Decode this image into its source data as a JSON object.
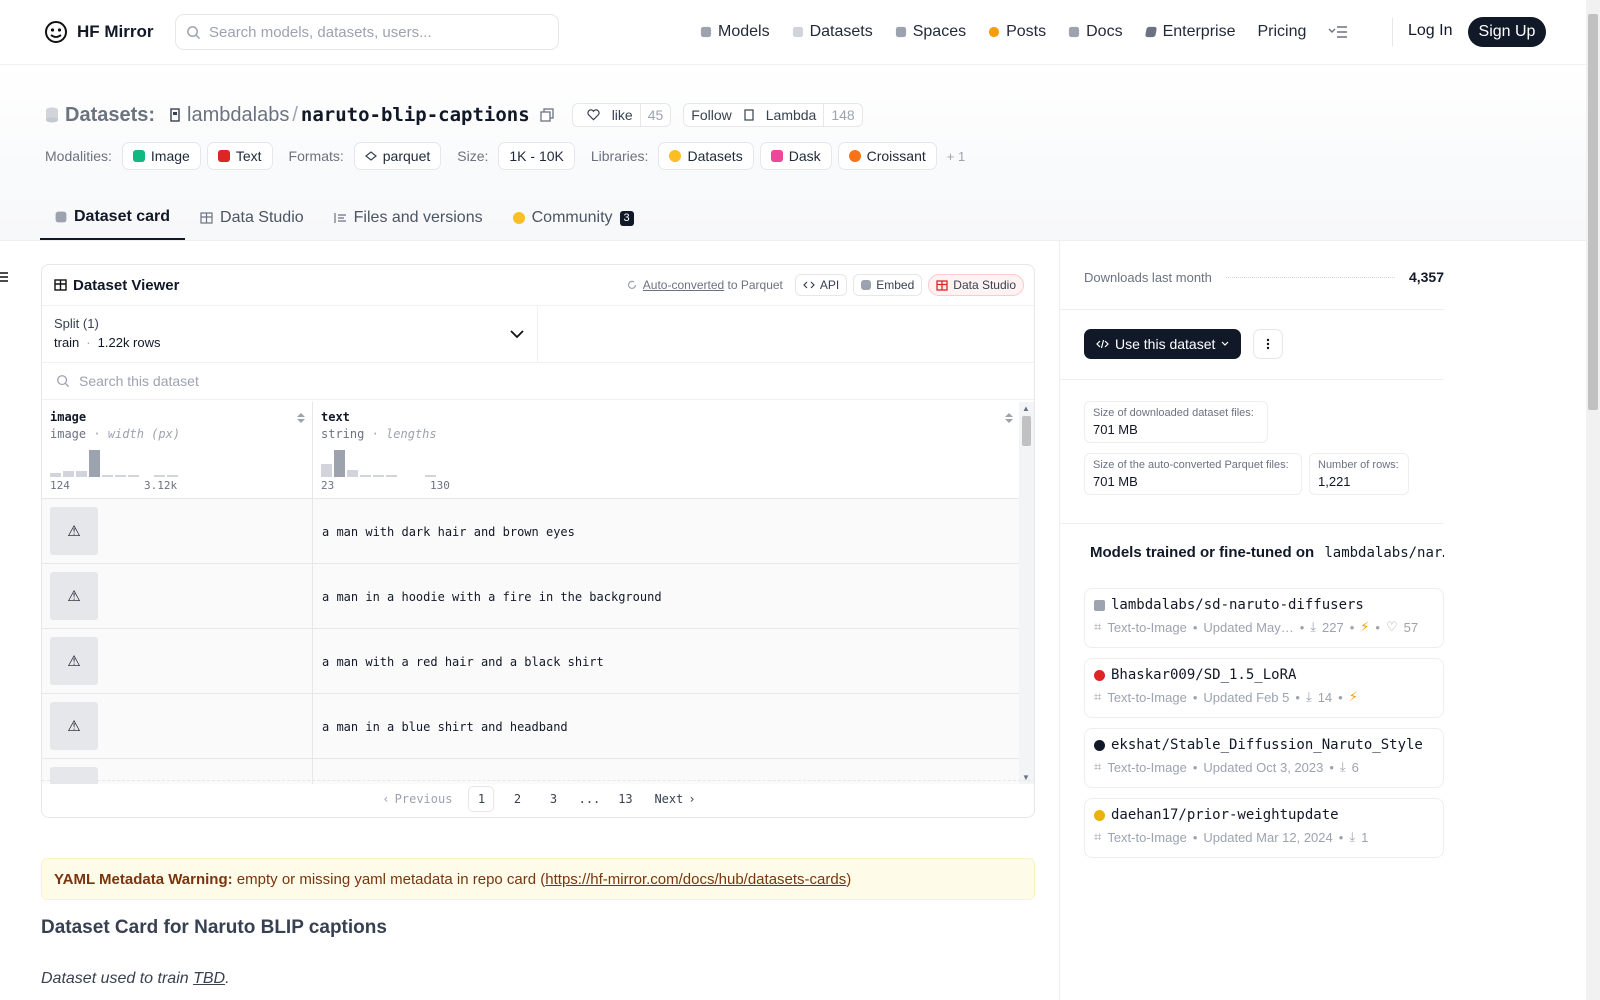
{
  "header": {
    "brand": "HF Mirror",
    "search_placeholder": "Search models, datasets, users...",
    "nav": [
      {
        "label": "Models",
        "icon": "cube-icon",
        "color": "#9ca3af"
      },
      {
        "label": "Datasets",
        "icon": "database-icon",
        "color": "#d1d5db"
      },
      {
        "label": "Spaces",
        "icon": "grid-icon",
        "color": "#9ca3af"
      },
      {
        "label": "Posts",
        "icon": "chat-icon",
        "color": "#f59e0b"
      },
      {
        "label": "Docs",
        "icon": "book-icon",
        "color": "#9ca3af"
      },
      {
        "label": "Enterprise",
        "icon": "enterprise-icon",
        "color": "#6b7280"
      },
      {
        "label": "Pricing",
        "icon": "",
        "color": ""
      }
    ],
    "login": "Log In",
    "signup": "Sign Up"
  },
  "repo": {
    "kind": "Datasets:",
    "owner": "lambdalabs",
    "name": "naruto-blip-captions",
    "like_label": "like",
    "likes": "45",
    "follow_label": "Follow",
    "org": "Lambda",
    "followers": "148",
    "modalities_label": "Modalities:",
    "modalities": [
      {
        "label": "Image",
        "color": "#10b981"
      },
      {
        "label": "Text",
        "color": "#dc2626"
      }
    ],
    "formats_label": "Formats:",
    "format": "parquet",
    "size_label": "Size:",
    "size": "1K - 10K",
    "libraries_label": "Libraries:",
    "libraries": [
      {
        "label": "Datasets",
        "color": "#fbbf24"
      },
      {
        "label": "Dask",
        "color": "#ec4899"
      },
      {
        "label": "Croissant",
        "color": "#f97316"
      }
    ],
    "more": "+ 1"
  },
  "tabs": [
    {
      "label": "Dataset card",
      "active": true
    },
    {
      "label": "Data Studio"
    },
    {
      "label": "Files and versions"
    },
    {
      "label": "Community",
      "badge": "3"
    }
  ],
  "viewer": {
    "title": "Dataset Viewer",
    "auto_converted": "Auto-converted",
    "to_parquet": " to Parquet",
    "api": "API",
    "embed": "Embed",
    "studio": "Data Studio",
    "split_label": "Split (1)",
    "split_name": "train",
    "split_rows": "1.22k rows",
    "search_placeholder": "Search this dataset",
    "columns": [
      {
        "name": "image",
        "type": "image",
        "stat": "width (px)",
        "min": "124",
        "max": "3.12k",
        "hist": [
          0.15,
          0.22,
          0.2,
          0.95,
          0.08,
          0.05,
          0.05,
          0,
          0.04,
          0.04
        ]
      },
      {
        "name": "text",
        "type": "string",
        "stat": "lengths",
        "min": "23",
        "max": "130",
        "hist": [
          0.45,
          0.95,
          0.25,
          0.08,
          0.06,
          0.06,
          0,
          0,
          0.04,
          0
        ]
      }
    ],
    "rows": [
      "a man with dark hair and brown eyes",
      "a man in a hoodie with a fire in the background",
      "a man with a red hair and a black shirt",
      "a man in a blue shirt and headband"
    ],
    "pager": {
      "prev": "Previous",
      "pages": [
        "1",
        "2",
        "3",
        "...",
        "13"
      ],
      "next": "Next"
    }
  },
  "warning": {
    "bold": "YAML Metadata Warning:",
    "text": " empty or missing yaml metadata in repo card (",
    "link": "https://hf-mirror.com/docs/hub/datasets-cards",
    "close": ")"
  },
  "card": {
    "title": "Dataset Card for Naruto BLIP captions",
    "text_prefix": "Dataset used to train ",
    "text_link": "TBD",
    "text_suffix": "."
  },
  "sidebar": {
    "downloads_label": "Downloads last month",
    "downloads": "4,357",
    "use_button": "Use this dataset",
    "stats": [
      {
        "label": "Size of downloaded dataset files:",
        "value": "701 MB"
      },
      {
        "label": "Size of the auto-converted Parquet files:",
        "value": "701 MB"
      },
      {
        "label": "Number of rows:",
        "value": "1,221"
      }
    ],
    "models_title_prefix": "Models trained or fine-tuned on ",
    "models_title_repo": "lambdalabs/nar…",
    "models": [
      {
        "name": "lambdalabs/sd-naruto-diffusers",
        "task": "Text-to-Image",
        "updated": "Updated May…",
        "downloads": "227",
        "likes": "57",
        "avatar": "#9ca3af"
      },
      {
        "name": "Bhaskar009/SD_1.5_LoRA",
        "task": "Text-to-Image",
        "updated": "Updated Feb 5",
        "downloads": "14",
        "likes": "",
        "avatar": "#dc2626"
      },
      {
        "name": "ekshat/Stable_Diffussion_Naruto_Style",
        "task": "Text-to-Image",
        "updated": "Updated Oct 3, 2023",
        "downloads": "6",
        "likes": "",
        "avatar": "#111827"
      },
      {
        "name": "daehan17/prior-weightupdate",
        "task": "Text-to-Image",
        "updated": "Updated Mar 12, 2024",
        "downloads": "1",
        "likes": "",
        "avatar": "#eab308"
      }
    ]
  }
}
